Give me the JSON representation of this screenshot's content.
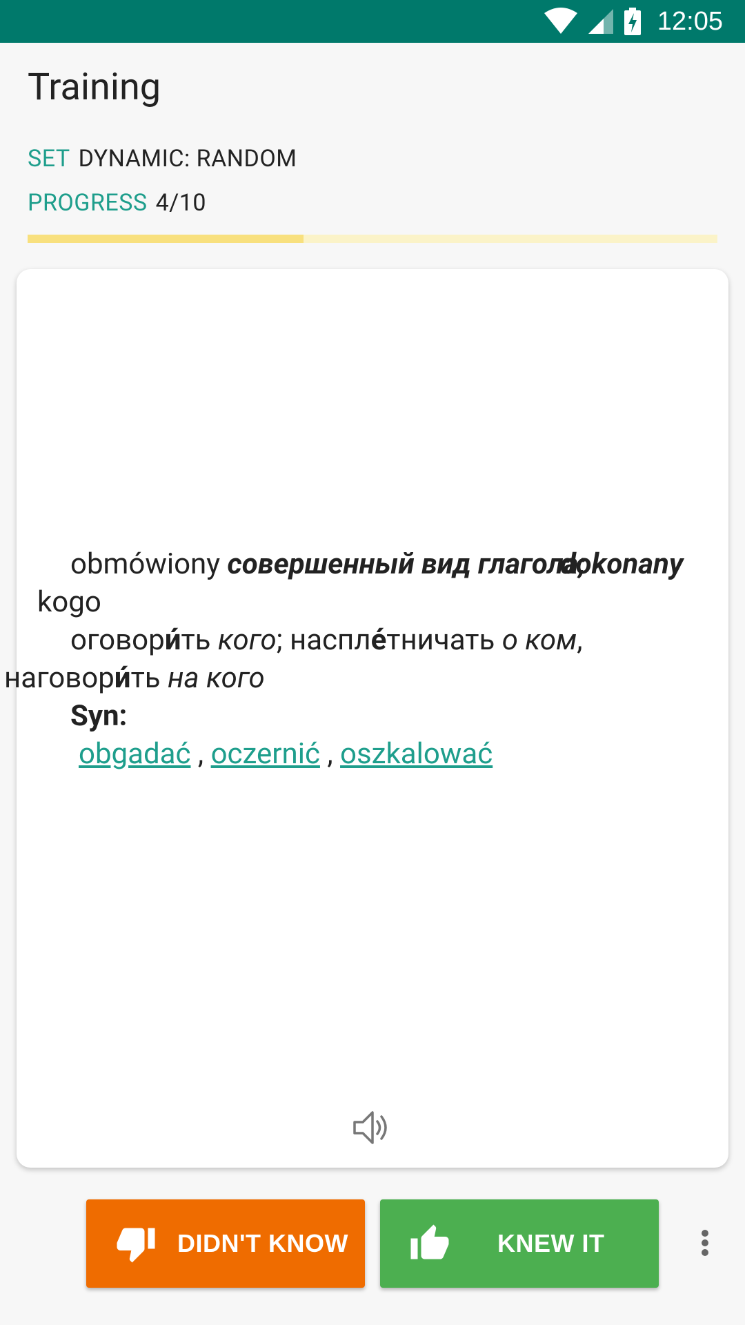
{
  "status_bar": {
    "time": "12:05"
  },
  "header": {
    "title": "Training"
  },
  "info": {
    "set_label": "SET",
    "set_value": "DYNAMIC: RANDOM",
    "progress_label": "PROGRESS",
    "progress_value": "4/10",
    "progress_fraction": 0.4
  },
  "card": {
    "headword": "obmówiony",
    "pos_ru": "совершенный вид глагола;",
    "pos_pl": "dokonany",
    "pos_obj": "kogo",
    "def1": "оговор",
    "def1_accent": "и́",
    "def1_end": "ть",
    "def1_obj": "кого",
    "def2_sep": "; наспл",
    "def2_accent": "е́",
    "def2_end": "тничать",
    "def2_obj": "о ком",
    "def2_comma": ",",
    "def3": "наговор",
    "def3_accent": "и́",
    "def3_end": "ть",
    "def3_obj": "на кого",
    "syn_label": "Syn:",
    "synonyms": [
      "obgadać",
      "oczernić",
      "oszkalować"
    ],
    "syn_separator": ","
  },
  "icons": {
    "speaker": "speaker-icon",
    "thumbs_down": "thumbs-down-icon",
    "thumbs_up": "thumbs-up-icon",
    "overflow": "more-vert-icon"
  },
  "actions": {
    "didnt_know_label": "DIDN'T KNOW",
    "knew_it_label": "KNEW IT"
  },
  "colors": {
    "status_bar": "#00796b",
    "accent": "#1e9e8c",
    "progress": "#f8e07e",
    "didnt_know": "#ef6c00",
    "knew_it": "#4caf50"
  }
}
